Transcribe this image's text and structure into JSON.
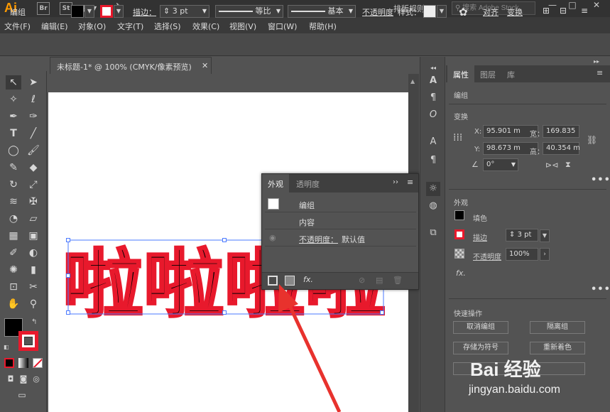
{
  "app": {
    "logo": "Ai",
    "bridge_label": "Br",
    "stock_label": "St",
    "workspace": "排版规则",
    "search_placeholder": "搜索 Adobe Stock"
  },
  "menu": [
    "文件(F)",
    "编辑(E)",
    "对象(O)",
    "文字(T)",
    "选择(S)",
    "效果(C)",
    "视图(V)",
    "窗口(W)",
    "帮助(H)"
  ],
  "control_bar": {
    "selection_type": "编组",
    "stroke_label": "描边：",
    "stroke_weight": "3 pt",
    "profile_label": "等比",
    "brush_label": "基本",
    "opacity_label": "不透明度",
    "style_label": "样式：",
    "align_label": "对齐",
    "transform_label": "变换"
  },
  "document": {
    "tab_title": "未标题-1* @ 100% (CMYK/像素预览)",
    "artwork_text": "啦啦啦啦"
  },
  "appearance_panel": {
    "tabs": [
      "外观",
      "透明度"
    ],
    "rows": {
      "group": "编组",
      "contents": "内容",
      "opacity_label": "不透明度：",
      "opacity_value": "默认值"
    }
  },
  "properties": {
    "tabs": [
      "属性",
      "图层",
      "库"
    ],
    "selection": "编组",
    "transform": {
      "title": "变换",
      "x_label": "X:",
      "x": "95.901 m",
      "y_label": "Y:",
      "y": "98.673 m",
      "w_label": "宽：",
      "w": "169.835",
      "h_label": "高：",
      "h": "40.354 m",
      "angle": "0°"
    },
    "appearance": {
      "title": "外观",
      "fill_label": "填色",
      "stroke_label": "描边",
      "stroke_weight": "3 pt",
      "opacity_label": "不透明度",
      "opacity_value": "100%"
    },
    "quick_actions": {
      "title": "快速操作",
      "ungroup": "取消编组",
      "isolate": "隔离组",
      "store_symbol": "存储为符号",
      "recolor": "重新着色"
    }
  },
  "watermark": {
    "logo": "Bai 经验",
    "url": "jingyan.baidu.com"
  },
  "colors": {
    "stroke_red": "#e8192c",
    "app_orange": "#ff9a00",
    "fill_black": "#000000"
  }
}
